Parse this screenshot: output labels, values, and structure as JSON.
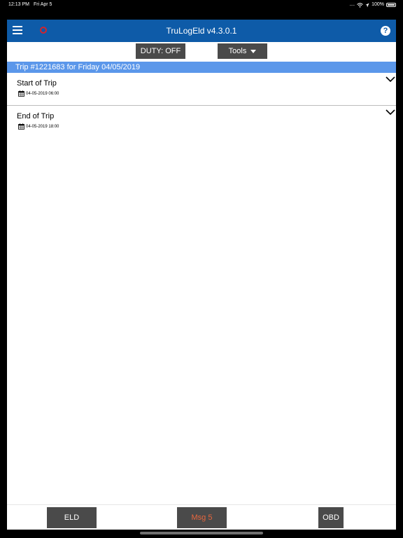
{
  "status_bar": {
    "time": "12:13 PM",
    "date": "Fri Apr 5",
    "signal_dots": "....",
    "battery_percent": "100%"
  },
  "nav": {
    "title": "TruLogEld v4.3.0.1",
    "help_glyph": "?"
  },
  "toolbar": {
    "duty_label": "DUTY: OFF",
    "tools_label": "Tools"
  },
  "trip": {
    "header": "Trip #1221683 for Friday 04/05/2019",
    "items": [
      {
        "title": "Start of Trip",
        "datetime": "04-05-2019 06:00"
      },
      {
        "title": "End of Trip",
        "datetime": "04-05-2019 18:00"
      }
    ]
  },
  "bottom": {
    "eld_label": "ELD",
    "msg_label": "Msg 5",
    "obd_label": "OBD"
  },
  "colors": {
    "nav_bg": "#0e5ba8",
    "trip_header_bg": "#5b97ea",
    "msg_accent": "#e8663d",
    "button_dark": "#4a4a4a"
  }
}
